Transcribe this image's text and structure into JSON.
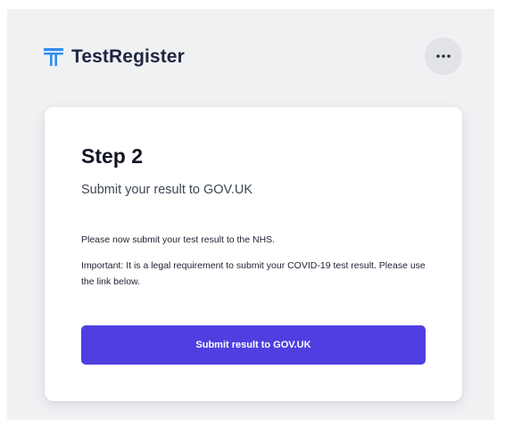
{
  "header": {
    "brand": "TestRegister",
    "logo_icon": "testregister-t-logo-icon",
    "menu_icon": "more-horizontal-icon"
  },
  "card": {
    "title": "Step 2",
    "subtitle": "Submit your result to GOV.UK",
    "paragraph_1": "Please now submit your test result to the NHS.",
    "paragraph_2": "Important: It is a legal requirement to submit your COVID-19 test result. Please use the link below.",
    "button_label": "Submit result to GOV.UK"
  },
  "colors": {
    "accent": "#4f3fe0",
    "logo_blue": "#2d8ef0",
    "background": "#f0f1f3"
  }
}
